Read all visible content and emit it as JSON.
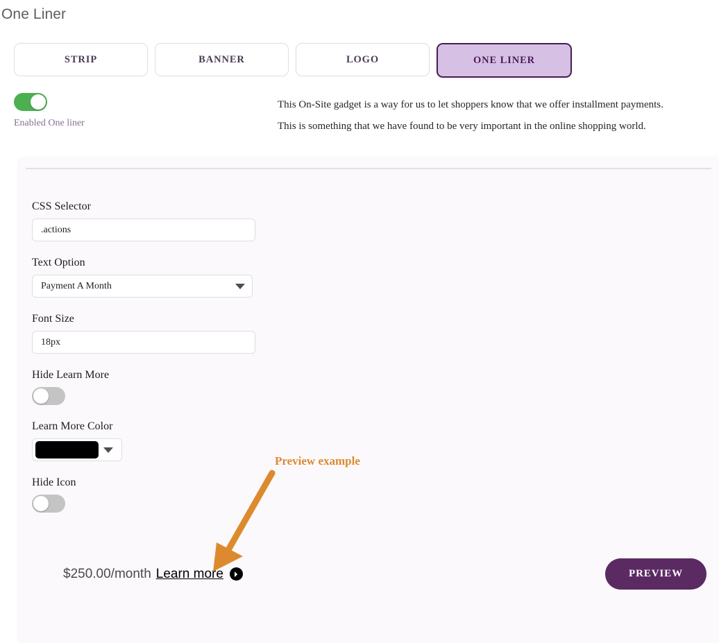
{
  "page": {
    "title": "One Liner"
  },
  "tabs": [
    {
      "label": "STRIP",
      "active": false
    },
    {
      "label": "BANNER",
      "active": false
    },
    {
      "label": "LOGO",
      "active": false
    },
    {
      "label": "ONE LINER",
      "active": true
    }
  ],
  "enable": {
    "toggle_state": "on",
    "label": "Enabled One liner",
    "description_line1": "This On-Site gadget is a way for us to let shoppers know that we offer installment payments.",
    "description_line2": "This is something that we have found to be very important in the online shopping world."
  },
  "form": {
    "css_selector": {
      "label": "CSS Selector",
      "value": ".actions",
      "placeholder": ".actions"
    },
    "text_option": {
      "label": "Text Option",
      "value": "Payment A Month",
      "options": [
        "Payment A Month"
      ]
    },
    "font_size": {
      "label": "Font Size",
      "value": "18px",
      "placeholder": "18px"
    },
    "hide_learn_more": {
      "label": "Hide Learn More",
      "toggle_state": "off"
    },
    "learn_more_color": {
      "label": "Learn More Color",
      "value": "#000000"
    },
    "hide_icon": {
      "label": "Hide Icon",
      "toggle_state": "off"
    }
  },
  "preview": {
    "price_text": "$250.00/month",
    "learn_more_label": "Learn more",
    "icon_glyph": "❯",
    "button_label": "PREVIEW"
  },
  "annotation": {
    "label": "Preview example",
    "color": "#dd8a2e"
  },
  "colors": {
    "accent_purple": "#5b2a63",
    "active_tab_bg": "#d6c1e5",
    "active_tab_border": "#4a1b57",
    "toggle_on": "#4caf50",
    "toggle_off": "#c4c4c4",
    "card_bg": "#fbf9fc",
    "annotation_orange": "#dd8a2e"
  }
}
